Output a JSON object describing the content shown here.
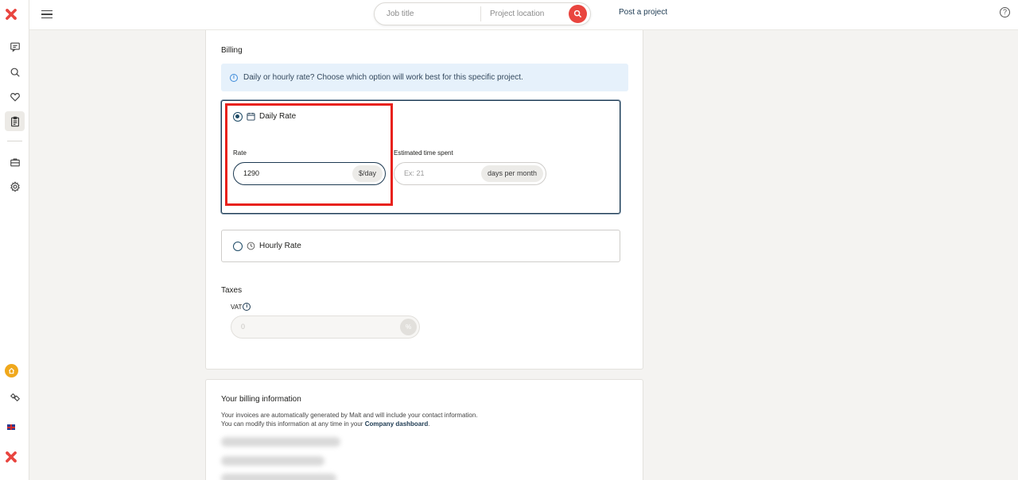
{
  "topbar": {
    "job_placeholder": "Job title",
    "location_placeholder": "Project location",
    "post_project": "Post a project",
    "help": "?"
  },
  "billing": {
    "title": "Billing",
    "info": "Daily or hourly rate? Choose which option will work best for this specific project.",
    "daily_label": "Daily Rate",
    "rate_label": "Rate",
    "rate_value": "1290",
    "rate_suffix": "$/day",
    "time_label": "Estimated time spent",
    "time_placeholder": "Ex: 21",
    "time_suffix": "days per month",
    "hourly_label": "Hourly Rate",
    "selected_option": "daily"
  },
  "taxes": {
    "title": "Taxes",
    "vat_label": "VAT",
    "vat_placeholder": "0",
    "vat_suffix": "%"
  },
  "billing_info": {
    "title": "Your billing information",
    "line1": "Your invoices are automatically generated by Malt and will include your contact information.",
    "line2_prefix": "You can modify this information at any time in your ",
    "line2_link": "Company dashboard",
    "line2_suffix": "."
  },
  "colors": {
    "brand_red": "#e9453f",
    "accent_navy": "#1d3a52",
    "info_bg": "#e6f1fb",
    "highlight": "#e8211c",
    "home_badge": "#f0a81c"
  },
  "icons": {
    "rail": [
      "malt-logo-icon",
      "messages-icon",
      "search-icon",
      "heart-icon",
      "clipboard-icon",
      "briefcase-icon",
      "settings-icon",
      "home-icon",
      "handshake-icon",
      "uk-flag-icon",
      "malt-logo-icon"
    ]
  }
}
